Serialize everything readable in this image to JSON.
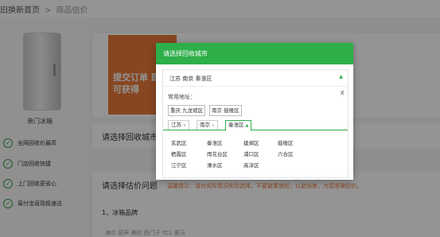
{
  "breadcrumb": {
    "home": "以旧换新首页",
    "sep": ">",
    "current": "商品估价"
  },
  "product": {
    "name": "单门冰箱"
  },
  "benefits": [
    {
      "icon": "check-circle-icon",
      "label": "全网回收价最高"
    },
    {
      "icon": "check-circle-icon",
      "label": "门店回收快捷"
    },
    {
      "icon": "check-circle-icon",
      "label": "上门回收更省心"
    },
    {
      "icon": "check-circle-icon",
      "label": "易付宝返现极速达"
    }
  ],
  "promo": {
    "text": "提交订单 即可获得"
  },
  "sections": {
    "city_title": "请选择回收城市",
    "estimate_title": "请选择估价问题",
    "hint": "温馨提示：请对实际情况实际选择，不要避重就轻，以避误差，为您准确估价。",
    "brand_title": "1、冰箱品牌",
    "brand_row": "海尔   容声   美的   西门子   TCL   奥马"
  },
  "modal": {
    "title": "请选择回收城市",
    "selected_value": "江苏 南京 秦淮区",
    "arrow_icon": "triangle-up-icon",
    "close": "x",
    "common_label": "常用地址：",
    "common_tags": [
      "重庆 九龙坡区",
      "南京 鼓楼区"
    ],
    "level_tabs": [
      {
        "label": "江苏",
        "active": false
      },
      {
        "label": "南京",
        "active": false
      },
      {
        "label": "秦淮区",
        "active": true
      }
    ],
    "districts": [
      "玄武区",
      "秦淮区",
      "建邺区",
      "鼓楼区",
      "栖霞区",
      "雨花台区",
      "浦口区",
      "六合区",
      "江宁区",
      "溧水区",
      "高淳区"
    ]
  },
  "colors": {
    "accent": "#2eaf4a",
    "promo": "#e8793a"
  }
}
